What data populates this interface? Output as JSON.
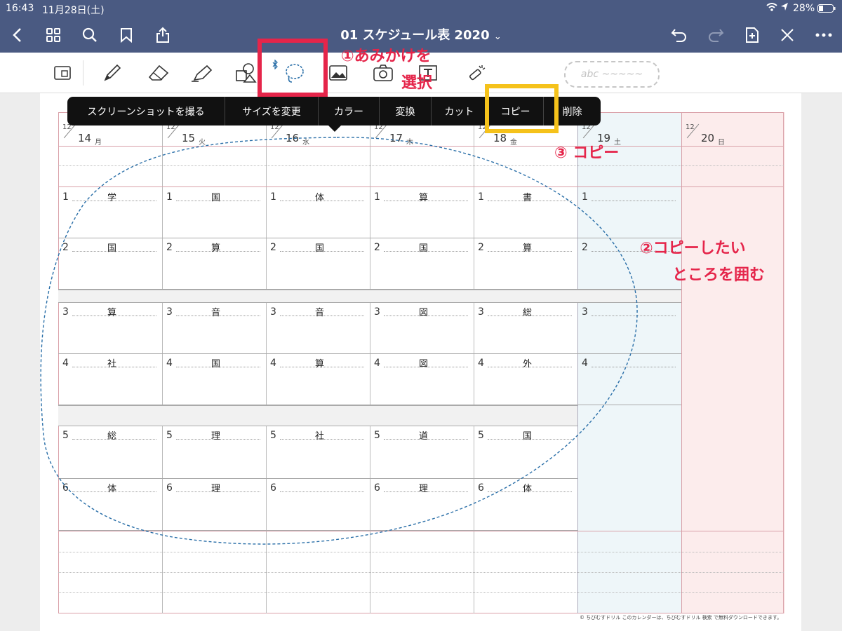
{
  "status": {
    "time": "16:43",
    "date": "11月28日(土)",
    "battery": "28%"
  },
  "nav": {
    "title": "01 スケジュール表 2020",
    "title_caret": "⌄"
  },
  "toolbar": {
    "text_placeholder": "abc ~~~~~"
  },
  "context_menu": {
    "items": [
      "スクリーンショットを撮る",
      "サイズを変更",
      "カラー",
      "変換",
      "カット",
      "コピー",
      "削除"
    ]
  },
  "calendar": {
    "month": "12",
    "days": [
      {
        "day": "14",
        "weekday": "月"
      },
      {
        "day": "15",
        "weekday": "火"
      },
      {
        "day": "16",
        "weekday": "水"
      },
      {
        "day": "17",
        "weekday": "木"
      },
      {
        "day": "18",
        "weekday": "金"
      },
      {
        "day": "19",
        "weekday": "土"
      },
      {
        "day": "20",
        "weekday": "日"
      }
    ],
    "periods": [
      "1",
      "2",
      "3",
      "4",
      "5",
      "6"
    ],
    "subjects": [
      [
        "学",
        "国",
        "算",
        "社",
        "総",
        "体"
      ],
      [
        "国",
        "算",
        "音",
        "国",
        "理",
        "理"
      ],
      [
        "体",
        "国",
        "音",
        "算",
        "社",
        ""
      ],
      [
        "算",
        "国",
        "図",
        "図",
        "道",
        "理"
      ],
      [
        "書",
        "算",
        "総",
        "外",
        "国",
        "体"
      ]
    ],
    "saturday_periods": [
      "1",
      "2",
      "3",
      "4"
    ],
    "footer": "© ちびむすドリル  このカレンダーは、ちびむすドリル 検索 で無料ダウンロードできます。"
  },
  "annotations": {
    "step1": "①あみかけを",
    "step1b": "選択",
    "step2": "②コピーしたい",
    "step2b": "ところを囲む",
    "step3": "③ コピー"
  },
  "colors": {
    "nav_bg": "#4a5a82",
    "saturday_bg": "#eef6f9",
    "sunday_bg": "#fcecec",
    "highlight_red": "#e5254a",
    "highlight_yellow": "#f5c21b",
    "lasso": "#2a6fa8"
  }
}
